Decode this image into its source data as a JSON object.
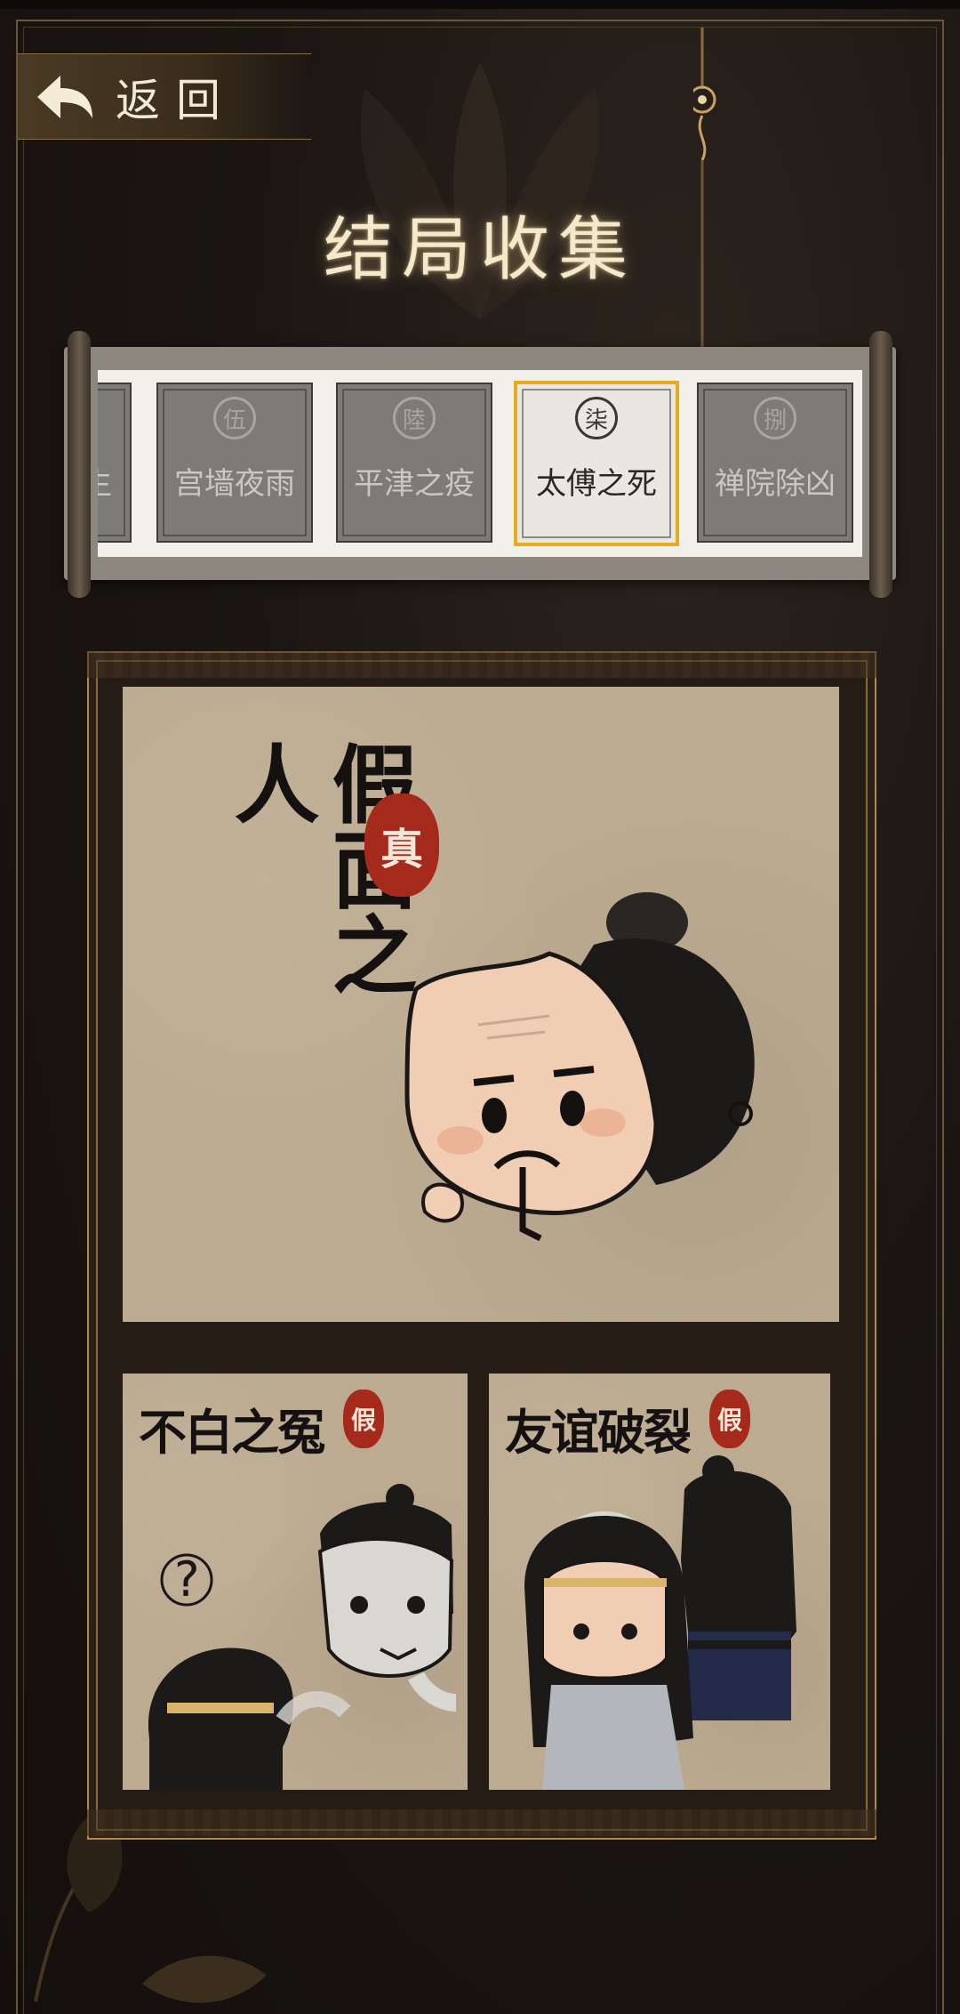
{
  "header": {
    "back_label": "返回",
    "title": "结局收集"
  },
  "chapters": [
    {
      "seal": "",
      "label": "生",
      "active": false
    },
    {
      "seal": "伍",
      "label": "宫墙夜雨",
      "active": false
    },
    {
      "seal": "陸",
      "label": "平津之疫",
      "active": false
    },
    {
      "seal": "柒",
      "label": "太傅之死",
      "active": true
    },
    {
      "seal": "捌",
      "label": "禅院除凶",
      "active": false
    }
  ],
  "endings": {
    "main": {
      "title": "假面之人",
      "stamp": "真"
    },
    "left": {
      "title": "不白之冤",
      "stamp": "假",
      "bubble": "?"
    },
    "right": {
      "title": "友谊破裂",
      "stamp": "假"
    }
  },
  "colors": {
    "accent_gold": "#e6ac1e",
    "stamp_red": "#a52a1b",
    "paper": "#bcab91"
  }
}
